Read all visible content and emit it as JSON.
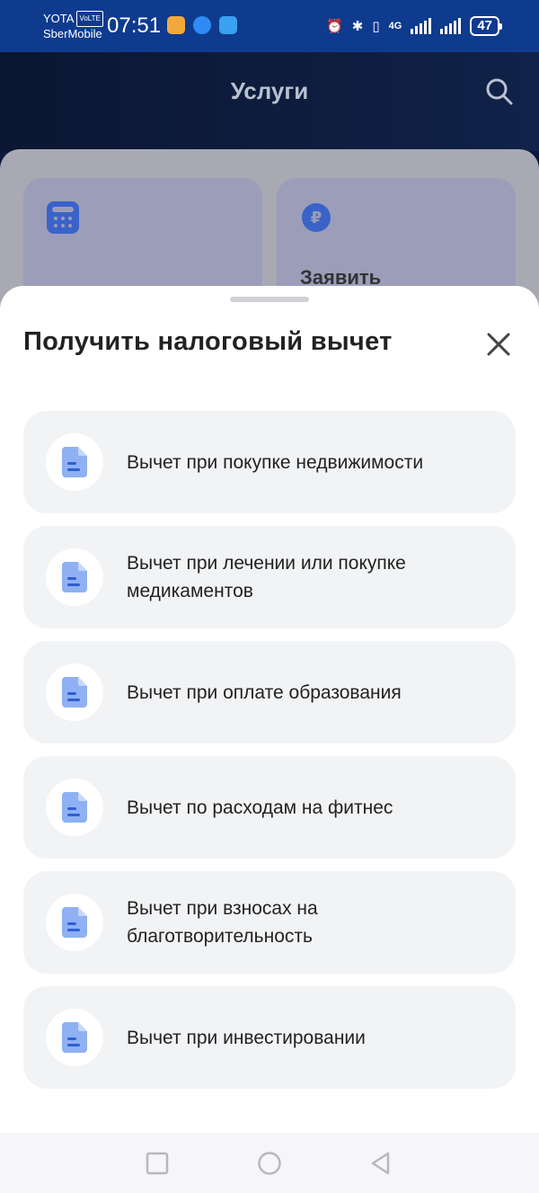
{
  "status_bar": {
    "carrier_top": "YOTA",
    "volte": "VoLTE",
    "carrier_bottom": "SberMobile",
    "time": "07:51",
    "network": "4G",
    "battery": "47"
  },
  "header": {
    "title": "Услуги"
  },
  "services": {
    "card_right_title": "Заявить"
  },
  "sheet": {
    "title": "Получить налоговый вычет",
    "items": [
      {
        "label": "Вычет при покупке недвижимости"
      },
      {
        "label": "Вычет при лечении или покупке медикаментов"
      },
      {
        "label": "Вычет при оплате образования"
      },
      {
        "label": "Вычет по расходам на фитнес"
      },
      {
        "label": "Вычет при взносах на благотворительность"
      },
      {
        "label": "Вычет при инвестировании"
      }
    ]
  },
  "colors": {
    "accent": "#4f7fe8",
    "doc_icon": "#8fb0f3",
    "item_bg": "#f2f3f5",
    "status_bar": "#0e3b8e"
  }
}
